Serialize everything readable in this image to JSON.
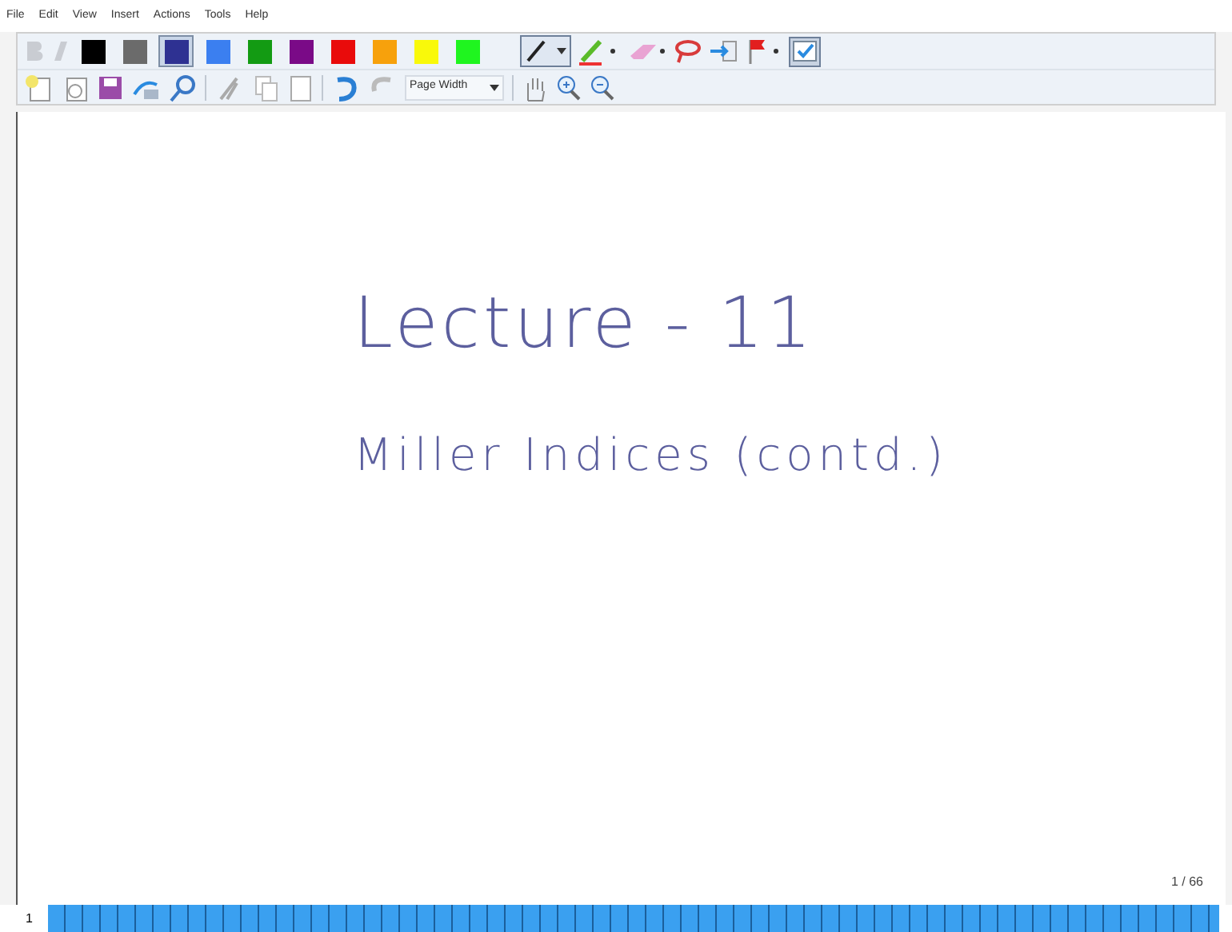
{
  "menu": [
    "File",
    "Edit",
    "View",
    "Insert",
    "Actions",
    "Tools",
    "Help"
  ],
  "pen_colors": [
    {
      "color": "#000000",
      "selected": false
    },
    {
      "color": "#6b6b6b",
      "selected": false
    },
    {
      "color": "#2e3192",
      "selected": true
    },
    {
      "color": "#3b7ff0",
      "selected": false
    },
    {
      "color": "#139b13",
      "selected": false
    },
    {
      "color": "#7a0a87",
      "selected": false
    },
    {
      "color": "#e90b0b",
      "selected": false
    },
    {
      "color": "#f7a10c",
      "selected": false
    },
    {
      "color": "#f9f90a",
      "selected": false
    },
    {
      "color": "#1ff51f",
      "selected": false
    }
  ],
  "zoom_dropdown": {
    "value": "Page Width"
  },
  "note": {
    "lines": [
      "Lecture - 11",
      "Miller Indices (contd.)"
    ]
  },
  "page_counter": "1 / 66",
  "page_strip": {
    "label": "1"
  }
}
